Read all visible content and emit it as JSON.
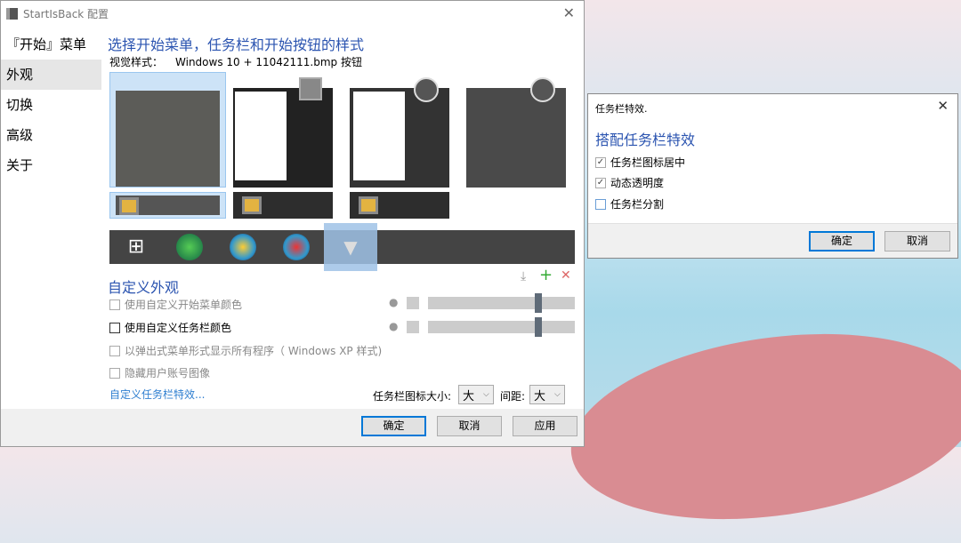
{
  "window": {
    "title": "StartIsBack 配置",
    "close": "✕"
  },
  "sidebar": {
    "items": [
      {
        "label": "『开始』菜单"
      },
      {
        "label": "外观"
      },
      {
        "label": "切换"
      },
      {
        "label": "高级"
      },
      {
        "label": "关于"
      }
    ]
  },
  "main": {
    "heading": "选择开始菜单，任务栏和开始按钮的样式",
    "visual_style_label": "视觉样式：",
    "visual_style_value": "Windows 10 + 11042111.bmp 按钮",
    "custom_heading": "自定义外观",
    "toolbar": {
      "download": "⤓",
      "add": "+",
      "remove": "✕"
    },
    "options": [
      {
        "label": "使用自定义开始菜单颜色",
        "checked": false,
        "enabled": false
      },
      {
        "label": "使用自定义任务栏颜色",
        "checked": false,
        "enabled": true
      },
      {
        "label": "以弹出式菜单形式显示所有程序（ Windows XP 样式)",
        "checked": false,
        "enabled": false
      },
      {
        "label": "隐藏用户账号图像",
        "checked": false,
        "enabled": false
      }
    ],
    "sliders": [
      {
        "value": 0.75
      },
      {
        "value": 0.75
      }
    ],
    "link": "自定义任务栏特效...",
    "icon_size_label": "任务栏图标大小:",
    "icon_size_value": "大",
    "spacing_label": "间距:",
    "spacing_value": "大"
  },
  "buttons": {
    "ok": "确定",
    "cancel": "取消",
    "apply": "应用"
  },
  "dialog": {
    "title": "任务栏特效.",
    "close": "✕",
    "heading": "搭配任务栏特效",
    "options": [
      {
        "label": "任务栏图标居中",
        "checked": true
      },
      {
        "label": "动态透明度",
        "checked": true
      },
      {
        "label": "任务栏分割",
        "checked": false
      }
    ],
    "ok": "确定",
    "cancel": "取消"
  },
  "colors": {
    "accent": "#2b54b0",
    "link": "#2f7fd0"
  }
}
